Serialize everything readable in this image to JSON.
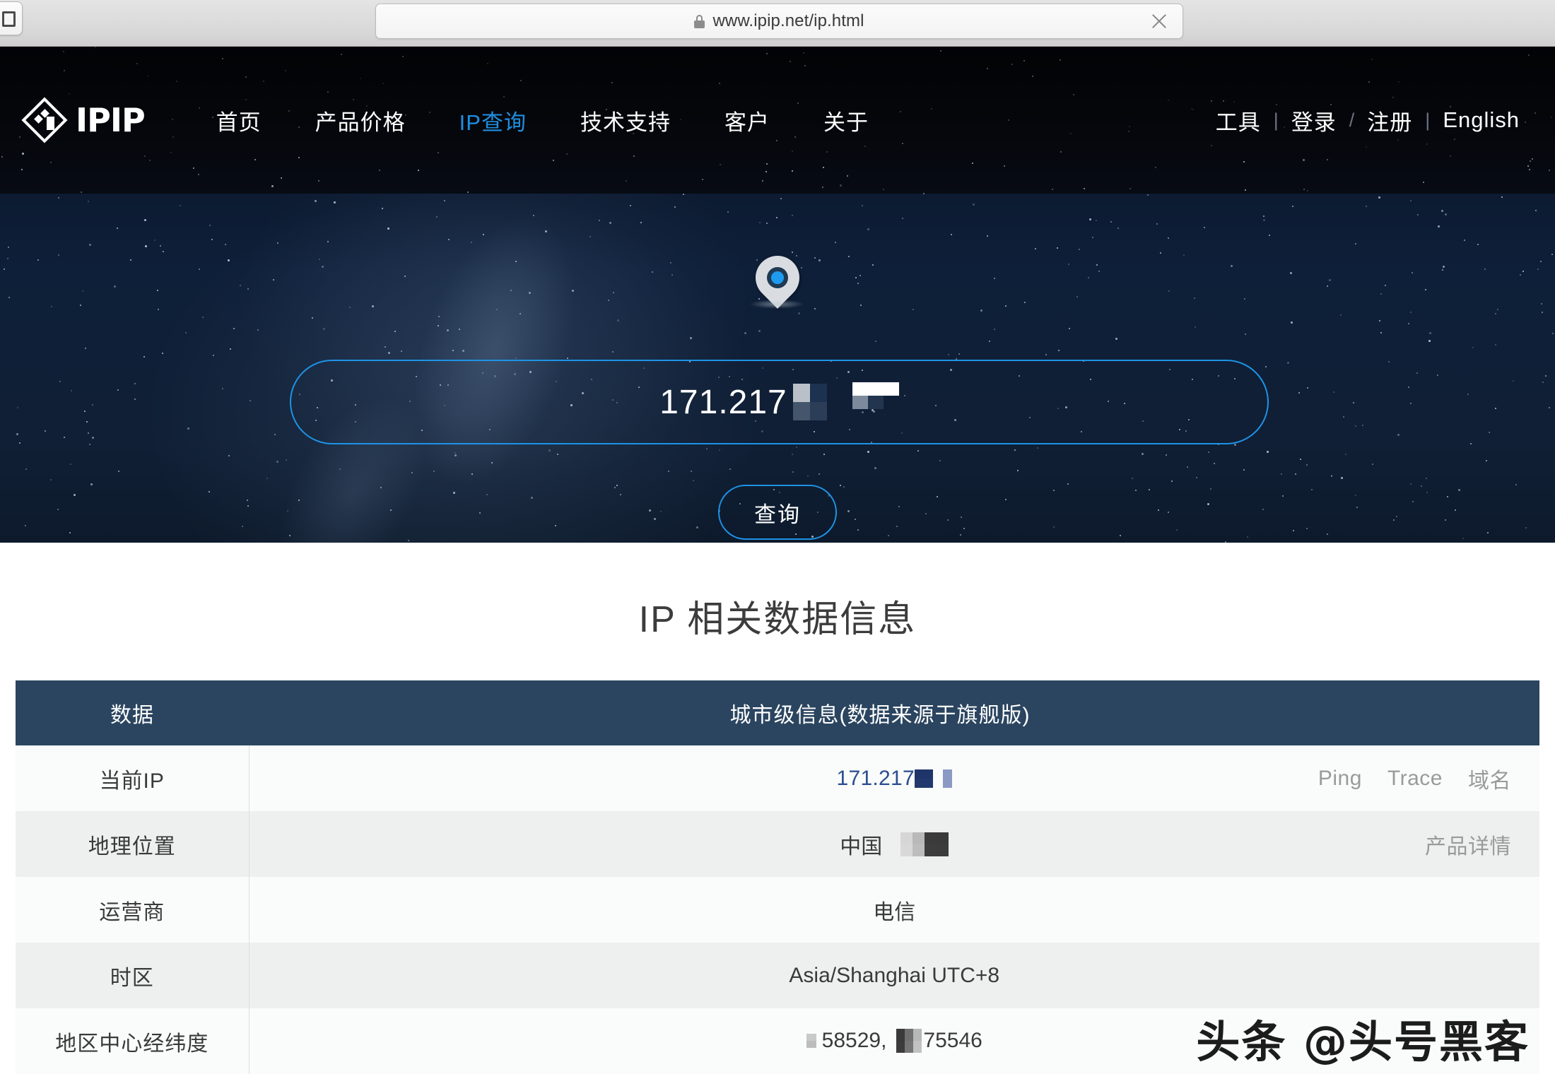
{
  "browser": {
    "url": "www.ipip.net/ip.html",
    "lock_icon": "lock-icon",
    "close_icon": "close-icon"
  },
  "header": {
    "logo_text": "IPIP",
    "nav_items": [
      {
        "label": "首页",
        "active": false
      },
      {
        "label": "产品价格",
        "active": false
      },
      {
        "label": "IP查询",
        "active": true
      },
      {
        "label": "技术支持",
        "active": false
      },
      {
        "label": "客户",
        "active": false
      },
      {
        "label": "关于",
        "active": false
      }
    ],
    "right_items": [
      {
        "label": "工具"
      },
      {
        "label": "登录"
      },
      {
        "label": "注册"
      },
      {
        "label": "English"
      }
    ],
    "separator_1": "|",
    "separator_2": "/",
    "separator_3": "|",
    "accent_color": "#1f8fe0"
  },
  "hero": {
    "pin_icon": "map-pin-icon",
    "ip_value": "171.217",
    "ip_redacted": true,
    "query_button": "查询",
    "border_color": "#1e93e6",
    "background_color": "#0e1f39"
  },
  "main": {
    "title": "IP 相关数据信息",
    "table": {
      "headers": [
        "数据",
        "城市级信息(数据来源于旗舰版)"
      ],
      "header_bg": "#2b4560",
      "rows": [
        {
          "label": "当前IP",
          "value": "171.217",
          "value_color": "#2a4d8f",
          "redacted": true,
          "actions": [
            "Ping",
            "Trace",
            "域名"
          ]
        },
        {
          "label": "地理位置",
          "value": "中国",
          "redacted": true,
          "actions": [
            "产品详情"
          ]
        },
        {
          "label": "运营商",
          "value": "电信",
          "redacted": false,
          "actions": []
        },
        {
          "label": "时区",
          "value": "Asia/Shanghai UTC+8",
          "redacted": false,
          "actions": []
        },
        {
          "label": "地区中心经纬度",
          "value_parts": [
            "58529,",
            "75546"
          ],
          "redacted": true,
          "actions": []
        }
      ]
    }
  },
  "watermark": {
    "text": "头条 @头号黑客"
  }
}
